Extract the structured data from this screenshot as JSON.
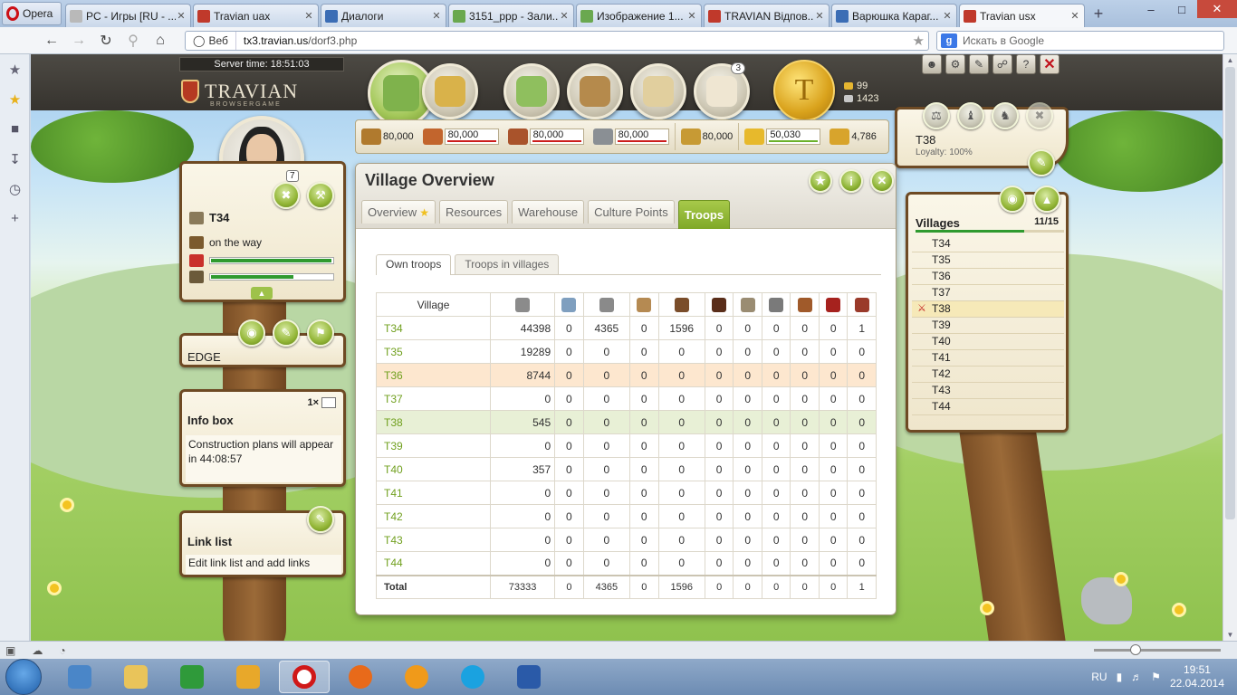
{
  "browser": {
    "menu_label": "Opera",
    "tabs": [
      {
        "label": "PC - Игры [RU - ...",
        "color": "#b9b9b9"
      },
      {
        "label": "Travian uax",
        "color": "#c0392b"
      },
      {
        "label": "Диалоги",
        "color": "#3b6db5"
      },
      {
        "label": "3151_ppp - Зали...",
        "color": "#6aa84f"
      },
      {
        "label": "Изображение 1...",
        "color": "#6aa84f"
      },
      {
        "label": "TRAVIAN Відпов...",
        "color": "#c0392b"
      },
      {
        "label": "Варюшка Караг...",
        "color": "#3b6db5"
      },
      {
        "label": "Travian usx",
        "color": "#c0392b"
      }
    ],
    "address_prefix": "Веб",
    "url_host": "tx3.travian.us",
    "url_path": "/dorf3.php",
    "search_placeholder": "Искать в Google"
  },
  "game": {
    "server_time_label": "Server time:",
    "server_time": "18:51:03",
    "logo_text": "TRAVIAN",
    "logo_sub": "BROWSERGAME",
    "reports_badge": "3",
    "gold": "99",
    "silver": "1423",
    "resources": [
      {
        "value": "80,000",
        "color": "#b07a2e",
        "bar": false
      },
      {
        "value": "80,000",
        "color": "#c2652d",
        "bar": true
      },
      {
        "value": "80,000",
        "color": "#a9532b",
        "bar": true
      },
      {
        "value": "80,000",
        "color": "#8a8f94",
        "bar": true
      },
      {
        "value": "80,000",
        "color": "#c79a34",
        "bar": false
      },
      {
        "value": "50,030",
        "color": "#e7b92c",
        "bar": true,
        "green": true
      },
      {
        "value": "4,786",
        "color": "#d8a42c",
        "bar": false
      }
    ],
    "hero": {
      "adventure_badge": "7",
      "village": "T34",
      "status": "on the way",
      "health_pct": 98,
      "exp_pct": 67
    },
    "alliance_title": "EDGE",
    "infobox": {
      "title": "Info box",
      "count": "1×",
      "text": "Construction plans will appear in 44:08:57"
    },
    "linklist": {
      "title": "Link list",
      "text": "Edit link list and add links"
    },
    "village_panel": {
      "name": "T38",
      "loyalty": "Loyalty: 100%"
    },
    "villages_panel": {
      "title": "Villages",
      "count": "11/15",
      "progress_fraction": 0.733,
      "current": "T38",
      "list": [
        "T34",
        "T35",
        "T36",
        "T37",
        "T38",
        "T39",
        "T40",
        "T41",
        "T42",
        "T43",
        "T44"
      ]
    },
    "overview": {
      "title": "Village Overview",
      "tabs": [
        "Overview",
        "Resources",
        "Warehouse",
        "Culture Points",
        "Troops"
      ],
      "active_tab": "Troops",
      "subtabs": [
        "Own troops",
        "Troops in villages"
      ],
      "table": {
        "village_header": "Village",
        "unit_colors": [
          "#8b8b8b",
          "#7f9fbf",
          "#8a8a8a",
          "#b58a52",
          "#7a4d2a",
          "#5a2e1a",
          "#9a8c72",
          "#7a7a7a",
          "#a05a2a",
          "#a6221e",
          "#9a3a2a"
        ],
        "rows": [
          {
            "name": "T34",
            "values": [
              "44398",
              "0",
              "4365",
              "0",
              "1596",
              "0",
              "0",
              "0",
              "0",
              "0",
              "1"
            ],
            "style": ""
          },
          {
            "name": "T35",
            "values": [
              "19289",
              "0",
              "0",
              "0",
              "0",
              "0",
              "0",
              "0",
              "0",
              "0",
              "0"
            ],
            "style": ""
          },
          {
            "name": "T36",
            "values": [
              "8744",
              "0",
              "0",
              "0",
              "0",
              "0",
              "0",
              "0",
              "0",
              "0",
              "0"
            ],
            "style": "hl-orange"
          },
          {
            "name": "T37",
            "values": [
              "0",
              "0",
              "0",
              "0",
              "0",
              "0",
              "0",
              "0",
              "0",
              "0",
              "0"
            ],
            "style": ""
          },
          {
            "name": "T38",
            "values": [
              "545",
              "0",
              "0",
              "0",
              "0",
              "0",
              "0",
              "0",
              "0",
              "0",
              "0"
            ],
            "style": "hl-green"
          },
          {
            "name": "T39",
            "values": [
              "0",
              "0",
              "0",
              "0",
              "0",
              "0",
              "0",
              "0",
              "0",
              "0",
              "0"
            ],
            "style": ""
          },
          {
            "name": "T40",
            "values": [
              "357",
              "0",
              "0",
              "0",
              "0",
              "0",
              "0",
              "0",
              "0",
              "0",
              "0"
            ],
            "style": ""
          },
          {
            "name": "T41",
            "values": [
              "0",
              "0",
              "0",
              "0",
              "0",
              "0",
              "0",
              "0",
              "0",
              "0",
              "0"
            ],
            "style": ""
          },
          {
            "name": "T42",
            "values": [
              "0",
              "0",
              "0",
              "0",
              "0",
              "0",
              "0",
              "0",
              "0",
              "0",
              "0"
            ],
            "style": ""
          },
          {
            "name": "T43",
            "values": [
              "0",
              "0",
              "0",
              "0",
              "0",
              "0",
              "0",
              "0",
              "0",
              "0",
              "0"
            ],
            "style": ""
          },
          {
            "name": "T44",
            "values": [
              "0",
              "0",
              "0",
              "0",
              "0",
              "0",
              "0",
              "0",
              "0",
              "0",
              "0"
            ],
            "style": ""
          }
        ],
        "total_label": "Total",
        "total_values": [
          "73333",
          "0",
          "4365",
          "0",
          "1596",
          "0",
          "0",
          "0",
          "0",
          "0",
          "1"
        ]
      }
    }
  },
  "taskbar": {
    "lang": "RU",
    "time": "19:51",
    "date": "22.04.2014"
  }
}
